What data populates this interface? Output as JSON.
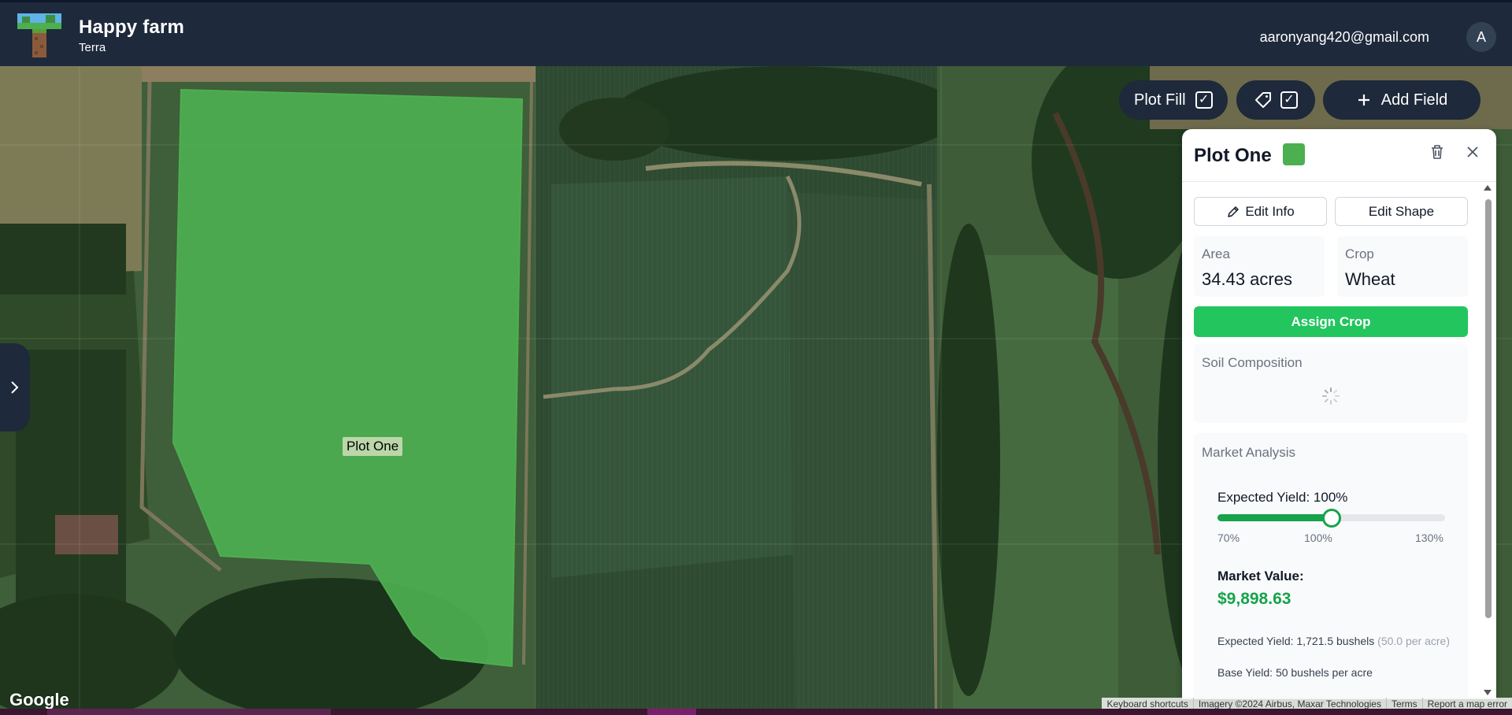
{
  "header": {
    "app_title": "Happy farm",
    "subtitle": "Terra",
    "user_email": "aaronyang420@gmail.com",
    "avatar_initial": "A"
  },
  "map": {
    "plot_label": "Plot One",
    "plot_fill_color": "#4caf50",
    "google_logo": "Google",
    "attribution": {
      "keyboard": "Keyboard shortcuts",
      "imagery": "Imagery ©2024 Airbus, Maxar Technologies",
      "terms": "Terms",
      "report": "Report a map error"
    }
  },
  "toolbar": {
    "plot_fill_label": "Plot Fill",
    "plot_fill_checked": true,
    "tags_checked": true,
    "add_field_label": "Add Field",
    "check_glyph": "✓"
  },
  "panel": {
    "title": "Plot One",
    "swatch_color": "#4caf50",
    "edit_info_label": "Edit Info",
    "edit_shape_label": "Edit Shape",
    "area_label": "Area",
    "area_value": "34.43 acres",
    "crop_label": "Crop",
    "crop_value": "Wheat",
    "assign_crop_label": "Assign Crop",
    "soil_title": "Soil Composition",
    "market": {
      "title": "Market Analysis",
      "expected_yield_label": "Expected Yield: 100%",
      "slider_min": 70,
      "slider_max": 130,
      "slider_value": 100,
      "tick_min": "70%",
      "tick_mid": "100%",
      "tick_max": "130%",
      "market_value_label": "Market Value:",
      "market_value": "$9,898.63",
      "expected_yield_detail": "Expected Yield: 1,721.5 bushels",
      "expected_yield_per_acre": "(50.0 per acre)",
      "base_yield_detail": "Base Yield: 50 bushels per acre"
    }
  },
  "colors": {
    "topbar": "#1e293b",
    "accent_green": "#22c55e",
    "value_green": "#16a34a"
  }
}
